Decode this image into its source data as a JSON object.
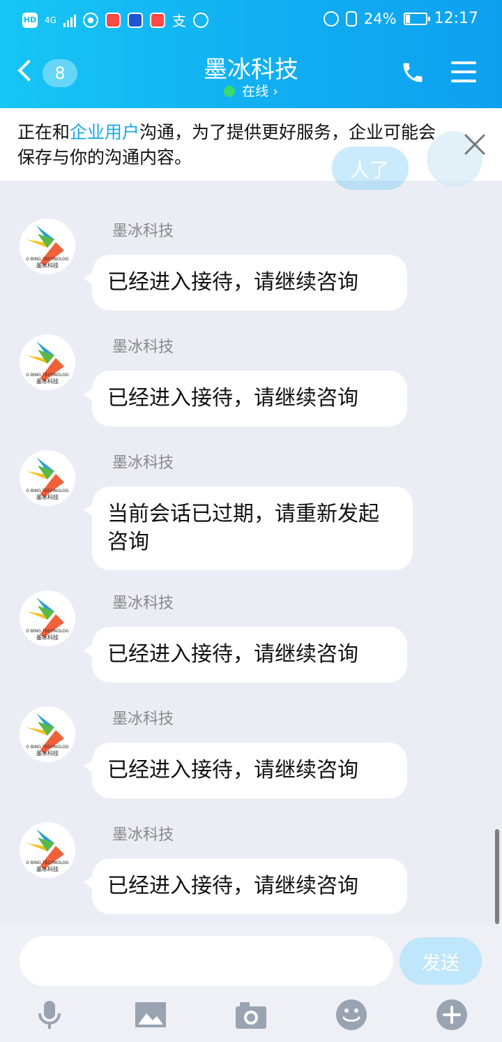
{
  "status_bar": {
    "network": "4G",
    "battery": "24%",
    "battery_level": 0.24,
    "time": "12:17"
  },
  "header": {
    "unread_count": "8",
    "title": "墨冰科技",
    "presence": "在线",
    "icons": [
      "back-chevron-icon",
      "phone-icon",
      "menu-icon"
    ]
  },
  "notice": {
    "before": "正在和",
    "highlight": "企业用户",
    "after": "沟通，为了提供更好服务，企业可能会保存与你的沟通内容。",
    "ghost_text": "人了"
  },
  "messages": [
    {
      "sender": "墨冰科技",
      "text": "已经进入接待，请继续咨询"
    },
    {
      "sender": "墨冰科技",
      "text": "已经进入接待，请继续咨询"
    },
    {
      "sender": "墨冰科技",
      "text": "当前会话已过期，请重新发起咨询"
    },
    {
      "sender": "墨冰科技",
      "text": "已经进入接待，请继续咨询"
    },
    {
      "sender": "墨冰科技",
      "text": "已经进入接待，请继续咨询"
    },
    {
      "sender": "墨冰科技",
      "text": "已经进入接待，请继续咨询"
    }
  ],
  "avatar": {
    "logo_line1": "O BING TECHNOLOG",
    "logo_line2": "墨冰科技"
  },
  "composer": {
    "value": "",
    "send_label": "发送",
    "tools": [
      "microphone-icon",
      "image-icon",
      "camera-icon",
      "emoji-icon",
      "plus-icon"
    ]
  },
  "colors": {
    "header_start": "#17c6f4",
    "header_end": "#0ea0ef",
    "accent": "#17a9e8",
    "background": "#eaedf4",
    "send_disabled": "#bfe6fb"
  }
}
